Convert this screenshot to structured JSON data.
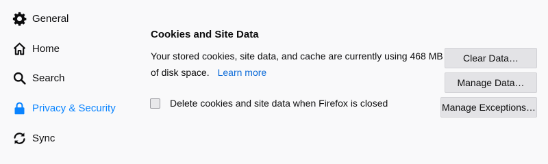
{
  "sidebar": {
    "items": [
      {
        "label": "General",
        "icon": "gear-icon"
      },
      {
        "label": "Home",
        "icon": "home-icon"
      },
      {
        "label": "Search",
        "icon": "search-icon"
      },
      {
        "label": "Privacy & Security",
        "icon": "lock-icon",
        "selected": true
      },
      {
        "label": "Sync",
        "icon": "sync-icon"
      }
    ]
  },
  "cookies": {
    "title": "Cookies and Site Data",
    "description_line1": "Your stored cookies, site data, and cache are currently using 468 MB",
    "description_line2": "of disk space.",
    "learn_more": "Learn more",
    "checkbox_label": "Delete cookies and site data when Firefox is closed",
    "checkbox_checked": false,
    "buttons": {
      "clear_data": "Clear Data…",
      "manage_data": "Manage Data…",
      "manage_exceptions": "Manage Exceptions…"
    }
  },
  "colors": {
    "accent": "#0a84ff",
    "link": "#0a6ad8",
    "background": "#f9f9fa",
    "button": "#e3e3e6"
  }
}
